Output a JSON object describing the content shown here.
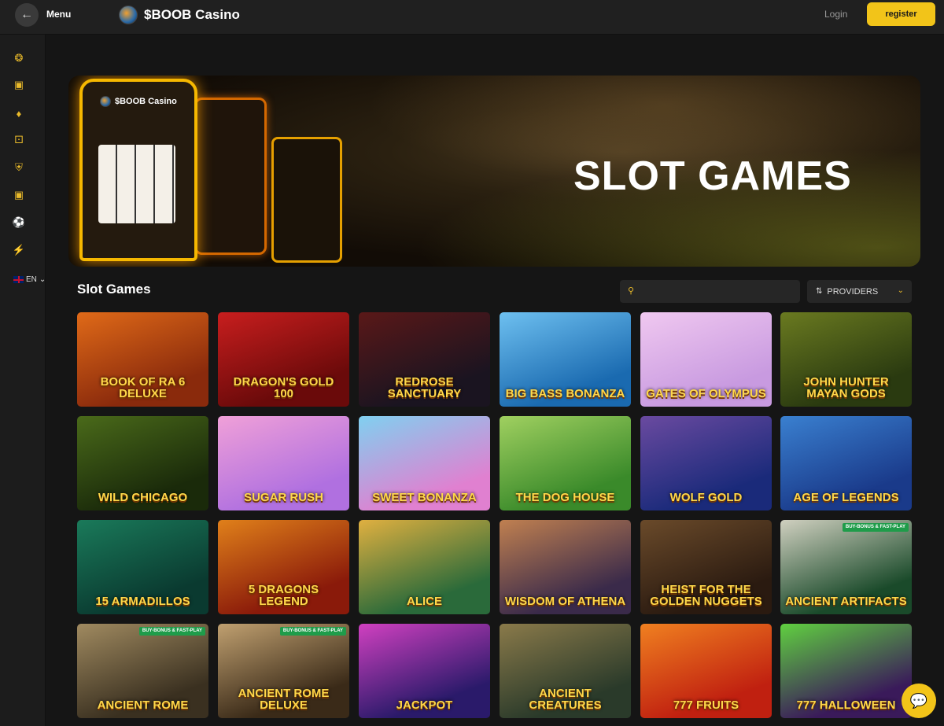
{
  "header": {
    "menu_label": "Menu",
    "brand": "$BOOB Casino",
    "login_label": "Login",
    "register_label": "register"
  },
  "sidebar": {
    "icons": [
      "casino-chip-icon",
      "slot-machine-icon",
      "cards-icon",
      "dice-icon",
      "shield-icon",
      "gamepad-icon",
      "soccer-ball-icon",
      "lightning-icon"
    ],
    "language": "EN"
  },
  "banner": {
    "brand": "$BOOB Casino",
    "title": "SLOT GAMES"
  },
  "section": {
    "title": "Slot Games",
    "search_placeholder": "",
    "providers_label": "PROVIDERS"
  },
  "games": [
    {
      "title": "Book of Ra 6 deluxe",
      "bg": "#8a2a0c",
      "bg2": "#e06a18",
      "badge": ""
    },
    {
      "title": "Dragon's Gold 100",
      "bg": "#6a0a0a",
      "bg2": "#c81e1e",
      "badge": ""
    },
    {
      "title": "Redrose Sanctuary",
      "bg": "#1a1420",
      "bg2": "#5a1818",
      "badge": ""
    },
    {
      "title": "Big Bass Bonanza",
      "bg": "#1a6ab0",
      "bg2": "#6ec0f0",
      "badge": ""
    },
    {
      "title": "Gates of Olympus",
      "bg": "#c89ae0",
      "bg2": "#f0c8f0",
      "badge": ""
    },
    {
      "title": "John Hunter Mayan Gods",
      "bg": "#2a3a10",
      "bg2": "#6a7a20",
      "badge": ""
    },
    {
      "title": "Wild Chicago",
      "bg": "#1a2a0a",
      "bg2": "#4a6a1a",
      "badge": ""
    },
    {
      "title": "Sugar Rush",
      "bg": "#b070e0",
      "bg2": "#f0a0d8",
      "badge": ""
    },
    {
      "title": "Sweet Bonanza",
      "bg": "#e080d0",
      "bg2": "#80d0f0",
      "badge": ""
    },
    {
      "title": "The Dog House",
      "bg": "#3a8a2a",
      "bg2": "#a0d060",
      "badge": ""
    },
    {
      "title": "Wolf Gold",
      "bg": "#1a2a7a",
      "bg2": "#6a4aa0",
      "badge": ""
    },
    {
      "title": "Age of Legends",
      "bg": "#1a3a8a",
      "bg2": "#3a80d0",
      "badge": ""
    },
    {
      "title": "15 Armadillos",
      "bg": "#0a3a30",
      "bg2": "#1a7a5a",
      "badge": ""
    },
    {
      "title": "5 Dragons Legend",
      "bg": "#8a1a0a",
      "bg2": "#e0801a",
      "badge": ""
    },
    {
      "title": "Alice",
      "bg": "#2a6a3a",
      "bg2": "#e0b040",
      "badge": ""
    },
    {
      "title": "Wisdom of Athena",
      "bg": "#3a2a4a",
      "bg2": "#c08050",
      "badge": ""
    },
    {
      "title": "Heist for the Golden Nuggets",
      "bg": "#2a1a10",
      "bg2": "#6a4a2a",
      "badge": ""
    },
    {
      "title": "Ancient Artifacts",
      "bg": "#1a4a2a",
      "bg2": "#d0d0c0",
      "badge": "BUY-BONUS & FAST-PLAY"
    },
    {
      "title": "Ancient Rome",
      "bg": "#3a3020",
      "bg2": "#a08a60",
      "badge": "BUY-BONUS & FAST-PLAY"
    },
    {
      "title": "Ancient Rome Deluxe",
      "bg": "#3a2a18",
      "bg2": "#c0a070",
      "badge": "BUY-BONUS & FAST-PLAY"
    },
    {
      "title": "Jackpot",
      "bg": "#2a1a6a",
      "bg2": "#d040c0",
      "badge": ""
    },
    {
      "title": "Ancient Creatures",
      "bg": "#2a3a2a",
      "bg2": "#8a7a4a",
      "badge": ""
    },
    {
      "title": "777 Fruits",
      "bg": "#c02010",
      "bg2": "#f08020",
      "badge": ""
    },
    {
      "title": "777 Halloween",
      "bg": "#3a1a5a",
      "bg2": "#60d040",
      "badge": ""
    }
  ]
}
